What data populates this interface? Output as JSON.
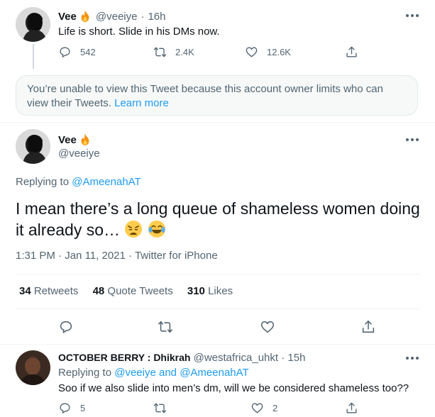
{
  "tweet1": {
    "name": "Vee",
    "handle": "@veeiye",
    "separator": "·",
    "time": "16h",
    "text": "Life is short. Slide in his DMs now.",
    "replies": "542",
    "retweets": "2.4K",
    "likes": "12.6K",
    "icons": [
      "flame-icon",
      "more-icon",
      "reply-icon",
      "retweet-icon",
      "like-icon",
      "share-icon"
    ]
  },
  "notice": {
    "text": "You’re unable to view this Tweet because this account owner limits who can view their Tweets.",
    "link": "Learn more"
  },
  "main_tweet": {
    "name": "Vee",
    "handle": "@veeiye",
    "replying_label": "Replying to",
    "replying_to": "@AmeenahAT",
    "text": "I mean there’s a long queue of shameless women doing it already so…",
    "emojis": [
      "weary-face",
      "tears-of-joy-face"
    ],
    "time": "1:31 PM",
    "date": "Jan 11, 2021",
    "source": "Twitter for iPhone",
    "separator": "·",
    "stats": {
      "retweets_count": "34",
      "retweets_label": "Retweets",
      "quotes_count": "48",
      "quotes_label": "Quote Tweets",
      "likes_count": "310",
      "likes_label": "Likes"
    }
  },
  "reply": {
    "name": "OCTOBER BERRY : Dhikrah",
    "handle": "@westafrica_uhkt",
    "separator": "·",
    "time": "15h",
    "replying_label": "Replying to",
    "replying_to_1": "@veeiye",
    "and_label": "and",
    "replying_to_2": "@AmeenahAT",
    "text": "Soo if we also slide into men’s dm, will we be considered shameless too??",
    "replies": "5",
    "likes": "2"
  },
  "colors": {
    "accent": "#1d9bf0",
    "secondary_text": "#536471",
    "primary_text": "#0f1419",
    "divider": "#eff3f4"
  }
}
